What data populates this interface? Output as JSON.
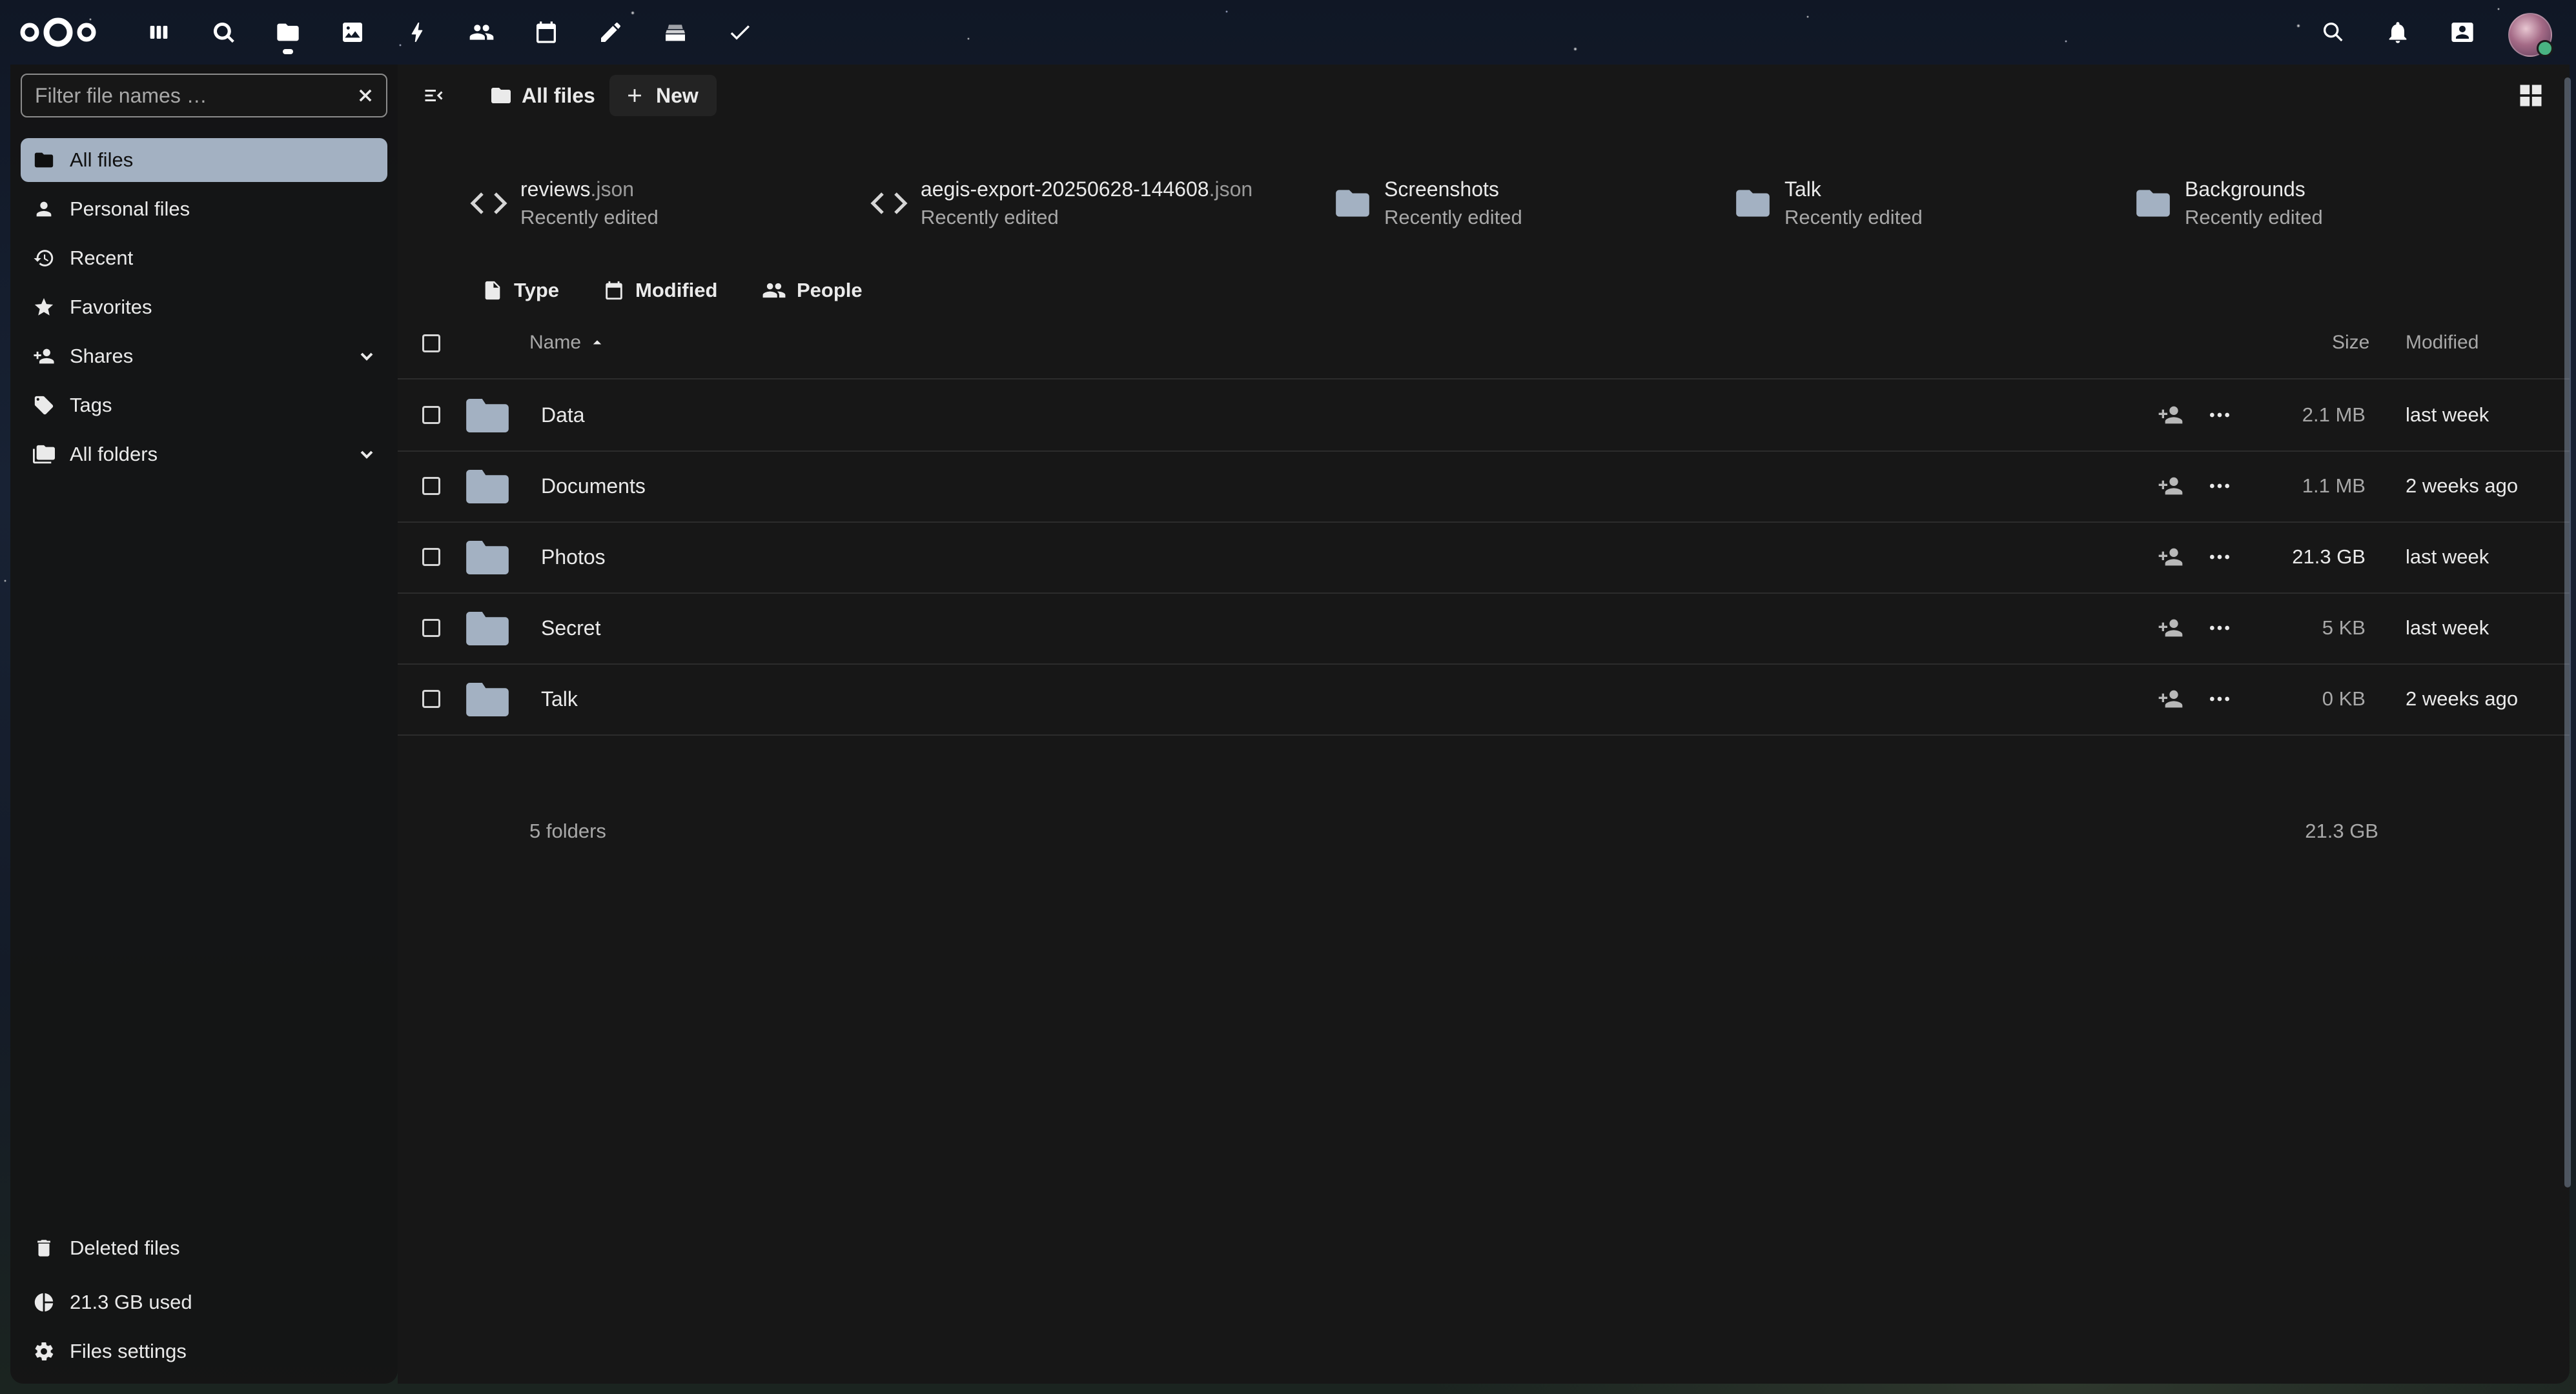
{
  "header": {
    "logo_icon": "nextcloud-logo",
    "apps": [
      {
        "name": "Dashboard",
        "icon": "dashboard-icon"
      },
      {
        "name": "Search",
        "icon": "search-app-icon"
      },
      {
        "name": "Files",
        "icon": "folder-icon",
        "active": true
      },
      {
        "name": "Photos",
        "icon": "image-icon"
      },
      {
        "name": "Activity",
        "icon": "lightning-icon"
      },
      {
        "name": "Contacts",
        "icon": "contacts-icon"
      },
      {
        "name": "Calendar",
        "icon": "calendar-icon"
      },
      {
        "name": "Notes",
        "icon": "pencil-icon"
      },
      {
        "name": "Deck",
        "icon": "deck-icon"
      },
      {
        "name": "Tasks",
        "icon": "checkmark-icon"
      }
    ],
    "right_icons": [
      "search-icon",
      "bell-icon",
      "contacts-menu-icon"
    ]
  },
  "sidebar": {
    "filter_placeholder": "Filter file names …",
    "items": [
      {
        "label": "All files",
        "icon": "folder-icon",
        "active": true
      },
      {
        "label": "Personal files",
        "icon": "user-icon"
      },
      {
        "label": "Recent",
        "icon": "history-icon"
      },
      {
        "label": "Favorites",
        "icon": "star-icon"
      },
      {
        "label": "Shares",
        "icon": "share-icon",
        "expandable": true
      },
      {
        "label": "Tags",
        "icon": "tag-icon"
      },
      {
        "label": "All folders",
        "icon": "folder-multiple-icon",
        "expandable": true
      }
    ],
    "footer": {
      "deleted": "Deleted files",
      "quota": "21.3 GB used",
      "settings": "Files settings"
    }
  },
  "main": {
    "breadcrumb": "All files",
    "new_button": "New",
    "recent_files": [
      {
        "name": "reviews",
        "ext": ".json",
        "sub": "Recently edited",
        "icon": "code-icon"
      },
      {
        "name": "aegis-export-20250628-144608",
        "ext": ".json",
        "sub": "Recently edited",
        "icon": "code-icon"
      },
      {
        "name": "Screenshots",
        "ext": "",
        "sub": "Recently edited",
        "icon": "folder-icon"
      },
      {
        "name": "Talk",
        "ext": "",
        "sub": "Recently edited",
        "icon": "folder-icon"
      },
      {
        "name": "Backgrounds",
        "ext": "",
        "sub": "Recently edited",
        "icon": "folder-icon"
      }
    ],
    "filters": [
      "Type",
      "Modified",
      "People"
    ],
    "table": {
      "columns": {
        "name": "Name",
        "size": "Size",
        "modified": "Modified"
      },
      "rows": [
        {
          "name": "Data",
          "size": "2.1 MB",
          "modified": "last week"
        },
        {
          "name": "Documents",
          "size": "1.1 MB",
          "modified": "2 weeks ago"
        },
        {
          "name": "Photos",
          "size": "21.3 GB",
          "modified": "last week"
        },
        {
          "name": "Secret",
          "size": "5 KB",
          "modified": "last week"
        },
        {
          "name": "Talk",
          "size": "0 KB",
          "modified": "2 weeks ago"
        }
      ],
      "summary": {
        "count": "5 folders",
        "total": "21.3 GB"
      }
    }
  },
  "colors": {
    "accent_nav_active": "#a3b1c2",
    "folder": "#a3b1c2",
    "panel": "#171717"
  }
}
